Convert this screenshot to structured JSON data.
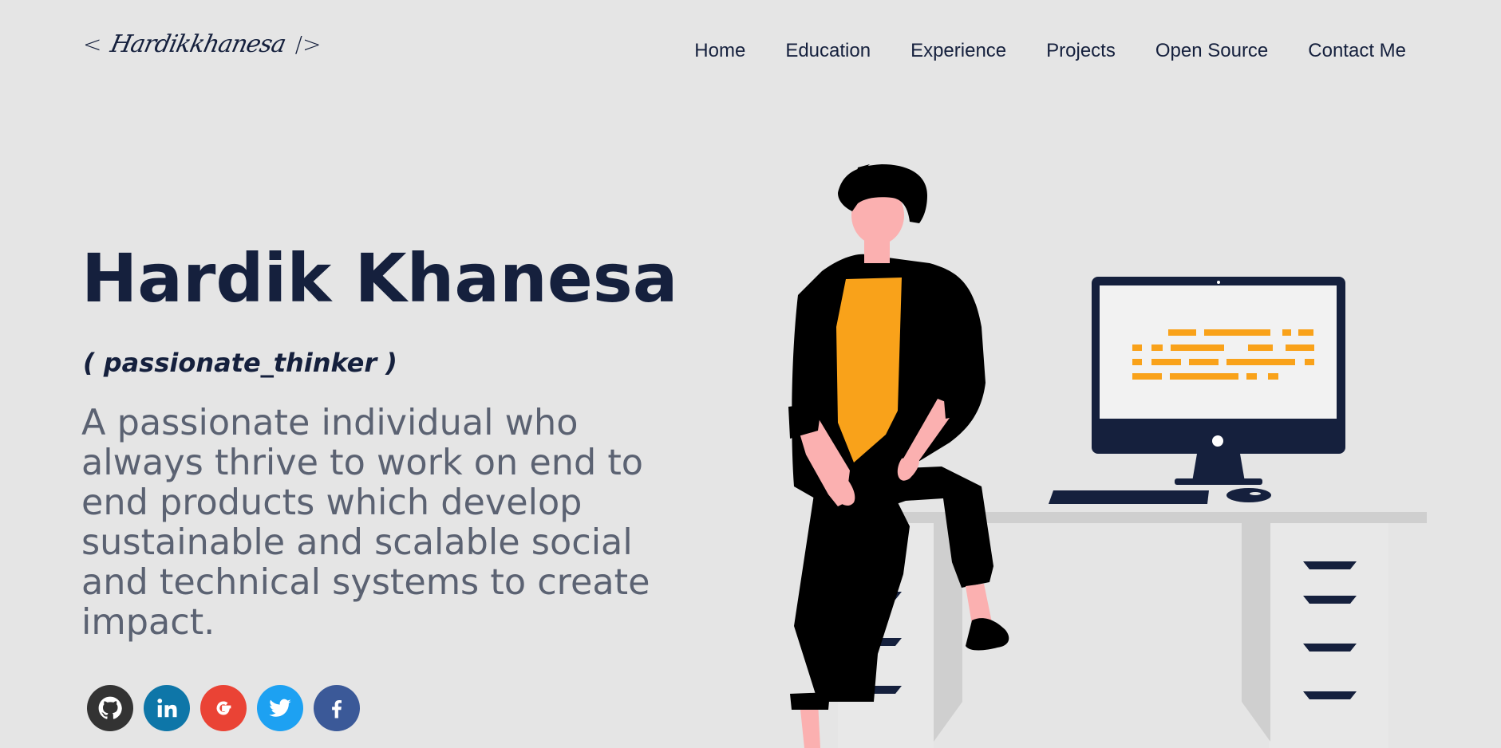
{
  "header": {
    "logo": {
      "open": "<",
      "signature": "Hardikkhanesa",
      "close": "/>"
    },
    "nav": [
      {
        "label": "Home"
      },
      {
        "label": "Education"
      },
      {
        "label": "Experience"
      },
      {
        "label": "Projects"
      },
      {
        "label": "Open Source"
      },
      {
        "label": "Contact Me"
      }
    ]
  },
  "hero": {
    "name": "Hardik Khanesa",
    "tagline": "( passionate_thinker )",
    "description": "A passionate individual who always thrive to work on end to end products which develop sustainable and scalable social and technical systems to create impact."
  },
  "social": [
    {
      "icon": "github-icon",
      "color": "#333333"
    },
    {
      "icon": "linkedin-icon",
      "color": "#0e76a8"
    },
    {
      "icon": "google-icon",
      "color": "#ea4335"
    },
    {
      "icon": "twitter-icon",
      "color": "#1da1f2"
    },
    {
      "icon": "facebook-icon",
      "color": "#3b5998"
    }
  ],
  "colors": {
    "background": "#e5e5e5",
    "primary_text": "#15203d",
    "secondary_text": "#5b6272",
    "accent": "#f9a21a"
  }
}
